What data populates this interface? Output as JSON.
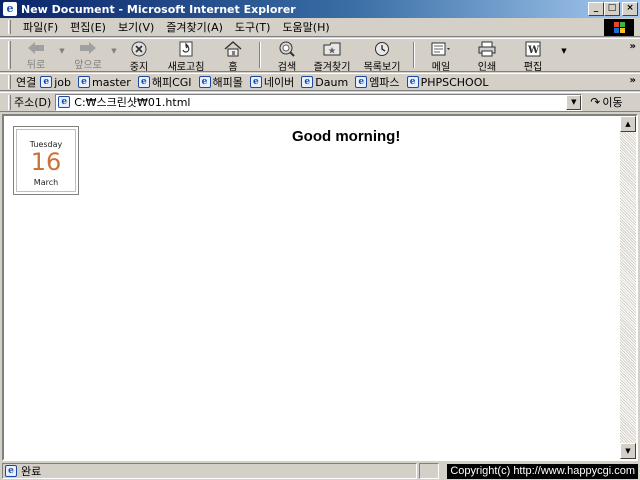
{
  "window": {
    "title": "New Document - Microsoft Internet Explorer",
    "buttons": {
      "minimize": "_",
      "maximize": "□",
      "close": "×"
    }
  },
  "menu": {
    "items": [
      {
        "label": "파일(F)"
      },
      {
        "label": "편집(E)"
      },
      {
        "label": "보기(V)"
      },
      {
        "label": "즐겨찾기(A)"
      },
      {
        "label": "도구(T)"
      },
      {
        "label": "도움말(H)"
      }
    ]
  },
  "toolbar": {
    "back": {
      "label": "뒤로",
      "icon": "back-arrow-icon"
    },
    "forward": {
      "label": "앞으로",
      "icon": "forward-arrow-icon"
    },
    "stop": {
      "label": "중지",
      "icon": "stop-icon"
    },
    "refresh": {
      "label": "새로고침",
      "icon": "refresh-icon"
    },
    "home": {
      "label": "홈",
      "icon": "home-icon"
    },
    "search": {
      "label": "검색",
      "icon": "search-icon"
    },
    "favorites": {
      "label": "즐겨찾기",
      "icon": "favorites-icon"
    },
    "history": {
      "label": "목록보기",
      "icon": "history-icon"
    },
    "mail": {
      "label": "메일",
      "icon": "mail-icon"
    },
    "print": {
      "label": "인쇄",
      "icon": "print-icon"
    },
    "edit": {
      "label": "편집",
      "icon": "edit-icon"
    },
    "more": "»"
  },
  "links": {
    "title": "연결",
    "items": [
      {
        "label": "job"
      },
      {
        "label": "master"
      },
      {
        "label": "해피CGI"
      },
      {
        "label": "해피몰"
      },
      {
        "label": "네이버"
      },
      {
        "label": "Daum"
      },
      {
        "label": "엠파스"
      },
      {
        "label": "PHPSCHOOL"
      }
    ],
    "more": "»"
  },
  "address": {
    "label": "주소(D)",
    "value": "C:₩스크린샷₩01.html",
    "go_label": "이동"
  },
  "page": {
    "calendar": {
      "day": "Tuesday",
      "date": "16",
      "month": "March"
    },
    "greeting": "Good morning!"
  },
  "status": {
    "text": "완료",
    "copyright": "Copyright(c) http://www.happycgi.com"
  },
  "colors": {
    "title_gradient_start": "#0a246a",
    "title_gradient_end": "#a6caf0",
    "chrome": "#d4d0c8",
    "calendar_date": "#c8733a"
  }
}
